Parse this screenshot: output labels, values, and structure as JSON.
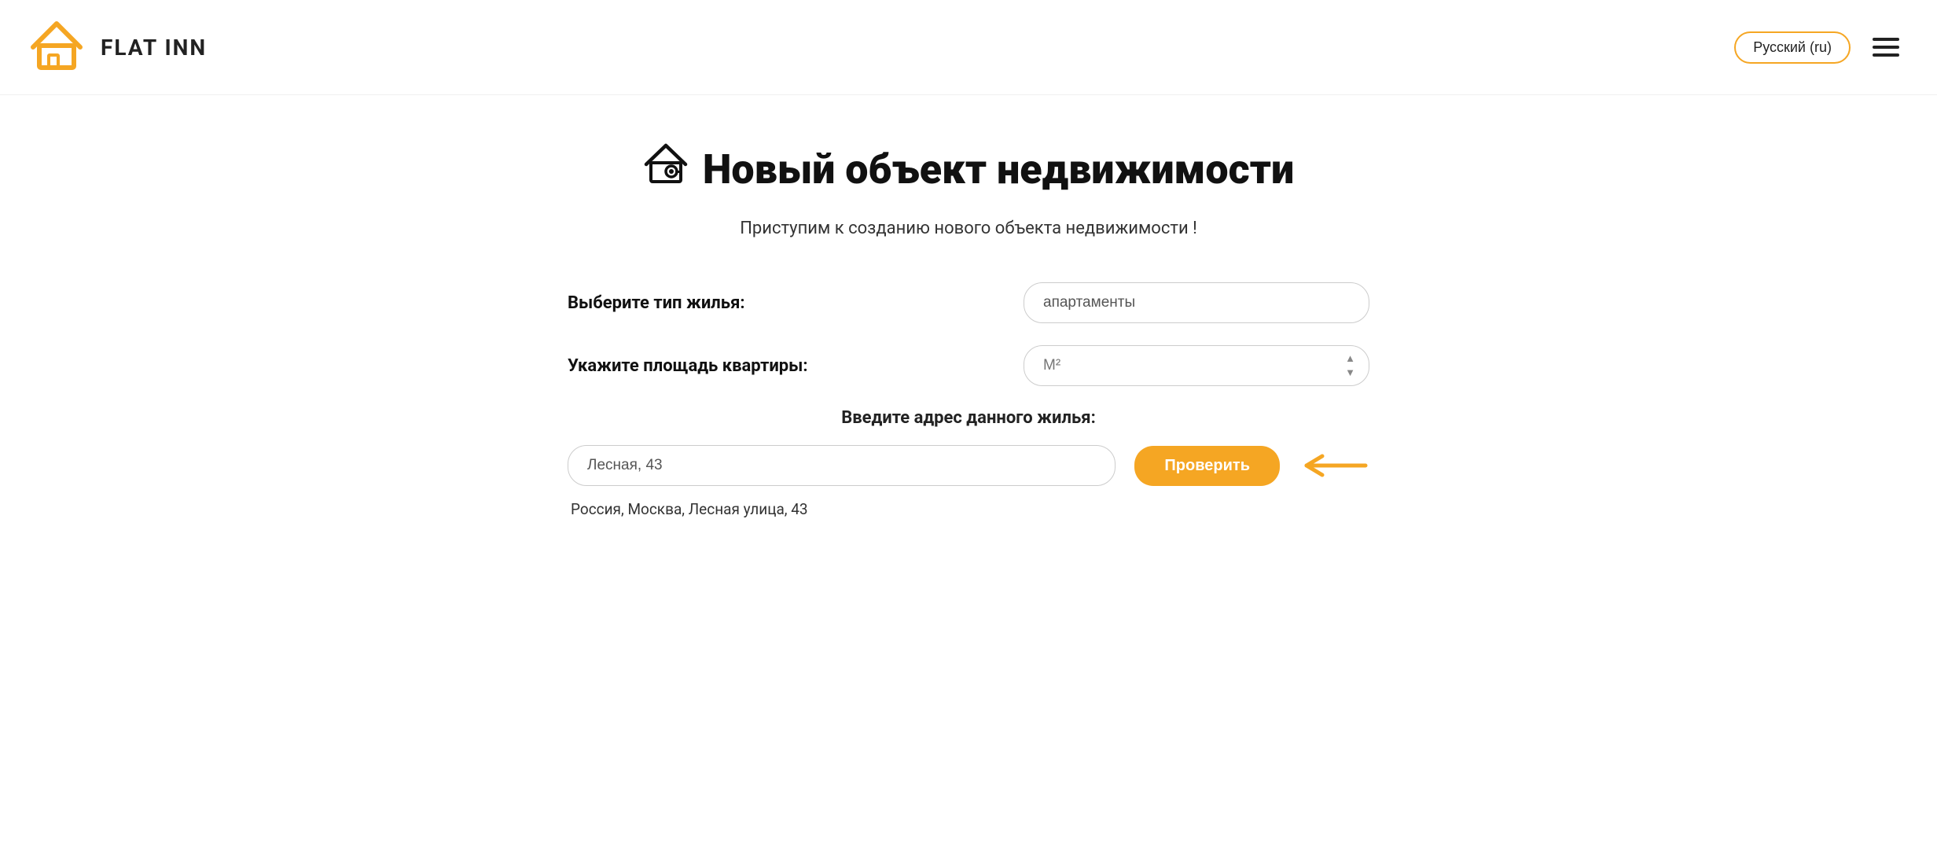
{
  "header": {
    "logo_text": "FLAT INN",
    "lang_selector": "Русский (ru)",
    "hamburger_label": "menu"
  },
  "page": {
    "icon_label": "house-key-icon",
    "title": "Новый объект недвижимости",
    "subtitle": "Приступим к созданию нового объекта недвижимости !",
    "form": {
      "housing_type_label": "Выберите тип жилья:",
      "housing_type_value": "апартаменты",
      "area_label": "Укажите площадь квартиры:",
      "area_placeholder": "М²",
      "address_section_title": "Введите адрес данного жилья:",
      "address_input_value": "Лесная, 43",
      "verify_button": "Проверить",
      "address_result": "Россия, Москва, Лесная улица, 43"
    }
  }
}
